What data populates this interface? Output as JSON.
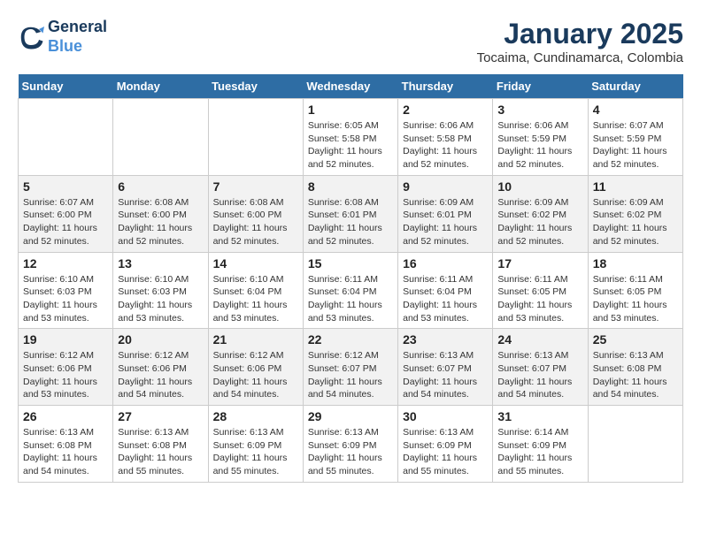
{
  "header": {
    "logo_line1": "General",
    "logo_line2": "Blue",
    "month": "January 2025",
    "location": "Tocaima, Cundinamarca, Colombia"
  },
  "weekdays": [
    "Sunday",
    "Monday",
    "Tuesday",
    "Wednesday",
    "Thursday",
    "Friday",
    "Saturday"
  ],
  "weeks": [
    [
      {
        "day": "",
        "info": ""
      },
      {
        "day": "",
        "info": ""
      },
      {
        "day": "",
        "info": ""
      },
      {
        "day": "1",
        "info": "Sunrise: 6:05 AM\nSunset: 5:58 PM\nDaylight: 11 hours\nand 52 minutes."
      },
      {
        "day": "2",
        "info": "Sunrise: 6:06 AM\nSunset: 5:58 PM\nDaylight: 11 hours\nand 52 minutes."
      },
      {
        "day": "3",
        "info": "Sunrise: 6:06 AM\nSunset: 5:59 PM\nDaylight: 11 hours\nand 52 minutes."
      },
      {
        "day": "4",
        "info": "Sunrise: 6:07 AM\nSunset: 5:59 PM\nDaylight: 11 hours\nand 52 minutes."
      }
    ],
    [
      {
        "day": "5",
        "info": "Sunrise: 6:07 AM\nSunset: 6:00 PM\nDaylight: 11 hours\nand 52 minutes."
      },
      {
        "day": "6",
        "info": "Sunrise: 6:08 AM\nSunset: 6:00 PM\nDaylight: 11 hours\nand 52 minutes."
      },
      {
        "day": "7",
        "info": "Sunrise: 6:08 AM\nSunset: 6:00 PM\nDaylight: 11 hours\nand 52 minutes."
      },
      {
        "day": "8",
        "info": "Sunrise: 6:08 AM\nSunset: 6:01 PM\nDaylight: 11 hours\nand 52 minutes."
      },
      {
        "day": "9",
        "info": "Sunrise: 6:09 AM\nSunset: 6:01 PM\nDaylight: 11 hours\nand 52 minutes."
      },
      {
        "day": "10",
        "info": "Sunrise: 6:09 AM\nSunset: 6:02 PM\nDaylight: 11 hours\nand 52 minutes."
      },
      {
        "day": "11",
        "info": "Sunrise: 6:09 AM\nSunset: 6:02 PM\nDaylight: 11 hours\nand 52 minutes."
      }
    ],
    [
      {
        "day": "12",
        "info": "Sunrise: 6:10 AM\nSunset: 6:03 PM\nDaylight: 11 hours\nand 53 minutes."
      },
      {
        "day": "13",
        "info": "Sunrise: 6:10 AM\nSunset: 6:03 PM\nDaylight: 11 hours\nand 53 minutes."
      },
      {
        "day": "14",
        "info": "Sunrise: 6:10 AM\nSunset: 6:04 PM\nDaylight: 11 hours\nand 53 minutes."
      },
      {
        "day": "15",
        "info": "Sunrise: 6:11 AM\nSunset: 6:04 PM\nDaylight: 11 hours\nand 53 minutes."
      },
      {
        "day": "16",
        "info": "Sunrise: 6:11 AM\nSunset: 6:04 PM\nDaylight: 11 hours\nand 53 minutes."
      },
      {
        "day": "17",
        "info": "Sunrise: 6:11 AM\nSunset: 6:05 PM\nDaylight: 11 hours\nand 53 minutes."
      },
      {
        "day": "18",
        "info": "Sunrise: 6:11 AM\nSunset: 6:05 PM\nDaylight: 11 hours\nand 53 minutes."
      }
    ],
    [
      {
        "day": "19",
        "info": "Sunrise: 6:12 AM\nSunset: 6:06 PM\nDaylight: 11 hours\nand 53 minutes."
      },
      {
        "day": "20",
        "info": "Sunrise: 6:12 AM\nSunset: 6:06 PM\nDaylight: 11 hours\nand 54 minutes."
      },
      {
        "day": "21",
        "info": "Sunrise: 6:12 AM\nSunset: 6:06 PM\nDaylight: 11 hours\nand 54 minutes."
      },
      {
        "day": "22",
        "info": "Sunrise: 6:12 AM\nSunset: 6:07 PM\nDaylight: 11 hours\nand 54 minutes."
      },
      {
        "day": "23",
        "info": "Sunrise: 6:13 AM\nSunset: 6:07 PM\nDaylight: 11 hours\nand 54 minutes."
      },
      {
        "day": "24",
        "info": "Sunrise: 6:13 AM\nSunset: 6:07 PM\nDaylight: 11 hours\nand 54 minutes."
      },
      {
        "day": "25",
        "info": "Sunrise: 6:13 AM\nSunset: 6:08 PM\nDaylight: 11 hours\nand 54 minutes."
      }
    ],
    [
      {
        "day": "26",
        "info": "Sunrise: 6:13 AM\nSunset: 6:08 PM\nDaylight: 11 hours\nand 54 minutes."
      },
      {
        "day": "27",
        "info": "Sunrise: 6:13 AM\nSunset: 6:08 PM\nDaylight: 11 hours\nand 55 minutes."
      },
      {
        "day": "28",
        "info": "Sunrise: 6:13 AM\nSunset: 6:09 PM\nDaylight: 11 hours\nand 55 minutes."
      },
      {
        "day": "29",
        "info": "Sunrise: 6:13 AM\nSunset: 6:09 PM\nDaylight: 11 hours\nand 55 minutes."
      },
      {
        "day": "30",
        "info": "Sunrise: 6:13 AM\nSunset: 6:09 PM\nDaylight: 11 hours\nand 55 minutes."
      },
      {
        "day": "31",
        "info": "Sunrise: 6:14 AM\nSunset: 6:09 PM\nDaylight: 11 hours\nand 55 minutes."
      },
      {
        "day": "",
        "info": ""
      }
    ]
  ]
}
